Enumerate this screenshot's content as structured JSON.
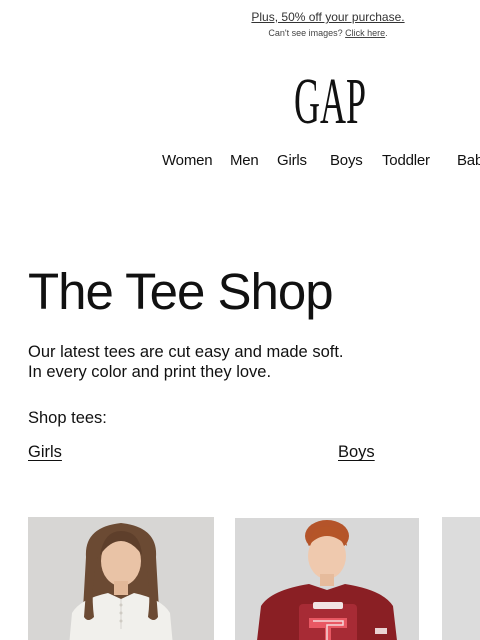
{
  "promo": {
    "headline": "Plus, 50% off your purchase.",
    "images_notice": "Can't see images?",
    "click_here": "Click here",
    "period": "."
  },
  "logo": {
    "text": "GAP"
  },
  "nav": {
    "items": [
      "Women",
      "Men",
      "Girls",
      "Boys",
      "Toddler",
      "Baby"
    ]
  },
  "hero": {
    "title": "The Tee Shop",
    "description_lines": [
      "Our latest tees are cut easy and made soft.",
      "In every color and print they love."
    ],
    "shop_label": "Shop tees:",
    "links": [
      "Girls",
      "Boys"
    ]
  },
  "products": [
    {
      "name": "girl-in-white-henley-tee",
      "background": "#d8d8d8",
      "shirt": "#f2f1ee"
    },
    {
      "name": "boy-in-burgundy-graphic-tee",
      "background": "#d9d9d9",
      "shirt": "#8a1f24"
    },
    {
      "name": "third-product-image",
      "background": "#dcdcdc"
    }
  ],
  "colors": {
    "text": "#111111",
    "promo_text": "#333333",
    "background": "#ffffff"
  }
}
